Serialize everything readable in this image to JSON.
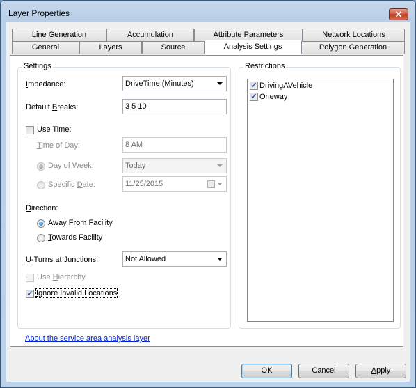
{
  "window": {
    "title": "Layer Properties",
    "close_glyph": "✕"
  },
  "tabs": {
    "row1": [
      {
        "label": "Line Generation"
      },
      {
        "label": "Accumulation"
      },
      {
        "label": "Attribute Parameters"
      },
      {
        "label": "Network Locations"
      }
    ],
    "row2": [
      {
        "label": "General"
      },
      {
        "label": "Layers"
      },
      {
        "label": "Source"
      },
      {
        "label": "Analysis Settings",
        "active": true
      },
      {
        "label": "Polygon Generation"
      }
    ]
  },
  "settings": {
    "group_label": "Settings",
    "impedance": {
      "label_pre": "",
      "label_u": "I",
      "label_post": "mpedance:",
      "value": "DriveTime (Minutes)"
    },
    "default_breaks": {
      "label_pre": "Default ",
      "label_u": "B",
      "label_post": "reaks:",
      "value": "3 5 10"
    },
    "use_time": {
      "label": "Use Time:",
      "checked": false
    },
    "time_of_day": {
      "label_pre": "",
      "label_u": "T",
      "label_post": "ime of Day:",
      "value": "8 AM"
    },
    "day_of_week": {
      "label_pre": "Day of ",
      "label_u": "W",
      "label_post": "eek:",
      "value": "Today",
      "selected": true
    },
    "specific_date": {
      "label_pre": "Specific ",
      "label_u": "D",
      "label_post": "ate:",
      "value": "11/25/2015",
      "selected": false
    },
    "direction": {
      "label_pre": "",
      "label_u": "D",
      "label_post": "irection:",
      "options": [
        {
          "label_pre": "A",
          "label_u": "w",
          "label_post": "ay From Facility",
          "selected": true
        },
        {
          "label_pre": "",
          "label_u": "T",
          "label_post": "owards Facility",
          "selected": false
        }
      ]
    },
    "uturns": {
      "label_pre": "",
      "label_u": "U",
      "label_post": "-Turns at Junctions:",
      "value": "Not Allowed"
    },
    "use_hierarchy": {
      "label_pre": "Use ",
      "label_u": "H",
      "label_post": "ierarchy",
      "checked": false
    },
    "ignore_invalid": {
      "label_pre": "",
      "label_u": "I",
      "label_post": "gnore Invalid Locations",
      "checked": true
    }
  },
  "restrictions": {
    "group_label": "Restrictions",
    "items": [
      {
        "label": "DrivingAVehicle",
        "checked": true
      },
      {
        "label": "Oneway",
        "checked": true
      }
    ]
  },
  "link": {
    "label": "About the service area analysis layer"
  },
  "buttons": {
    "ok": "OK",
    "cancel": "Cancel",
    "apply_u": "A",
    "apply_post": "pply"
  },
  "check_glyph": "✓"
}
